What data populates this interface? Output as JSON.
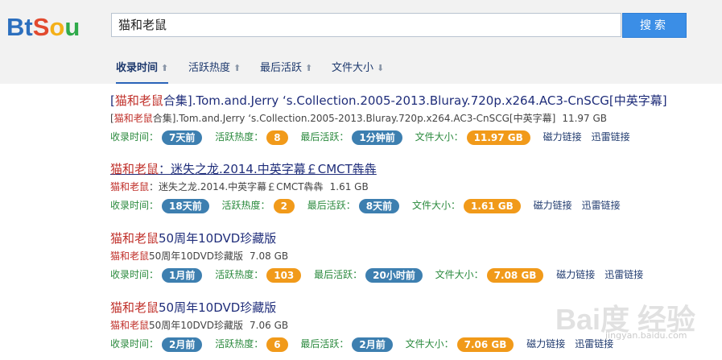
{
  "logo": {
    "parts": [
      {
        "text": "B",
        "color": "#2c6fbe"
      },
      {
        "text": "t",
        "color": "#2c6fbe"
      },
      {
        "text": "S",
        "color": "#e24a2f"
      },
      {
        "text": "o",
        "color": "#f4b019"
      },
      {
        "text": "u",
        "color": "#2faa4a"
      }
    ]
  },
  "search": {
    "value": "猫和老鼠",
    "button": "搜索"
  },
  "sort": [
    {
      "label": "收录时间",
      "active": true
    },
    {
      "label": "活跃热度",
      "active": false
    },
    {
      "label": "最后活跃",
      "active": false
    },
    {
      "label": "文件大小",
      "active": false
    }
  ],
  "labels": {
    "added": "收录时间：",
    "heat": "活跃热度：",
    "last": "最后活跃：",
    "size": "文件大小：",
    "magnet": "磁力链接",
    "thunder": "迅雷链接"
  },
  "results": [
    {
      "title_prefix": "[",
      "title_hl": "猫和老鼠",
      "title_rest": "合集].Tom.and.Jerry ‘s.Collection.2005-2013.Bluray.720p.x264.AC3-CnSCG[中英字幕]",
      "sub_prefix": "[",
      "sub_hl": "猫和老鼠",
      "sub_rest": "合集].Tom.and.Jerry ‘s.Collection.2005-2013.Bluray.720p.x264.AC3-CnSCG[中英字幕]",
      "sub_size": "11.97 GB",
      "added": "7天前",
      "heat": "8",
      "last": "1分钟前",
      "size": "11.97 GB",
      "underline": false
    },
    {
      "title_prefix": "",
      "title_hl": "猫和老鼠",
      "title_rest": "：迷失之龙.2014.中英字幕￡CMCT犇犇",
      "sub_prefix": "",
      "sub_hl": "猫和老鼠",
      "sub_rest": "：迷失之龙.2014.中英字幕￡CMCT犇犇",
      "sub_size": "1.61 GB",
      "added": "18天前",
      "heat": "2",
      "last": "8天前",
      "size": "1.61 GB",
      "underline": true
    },
    {
      "title_prefix": "",
      "title_hl": "猫和老鼠",
      "title_rest": "50周年10DVD珍藏版",
      "sub_prefix": "",
      "sub_hl": "猫和老鼠",
      "sub_rest": "50周年10DVD珍藏版",
      "sub_size": "7.08 GB",
      "added": "1月前",
      "heat": "103",
      "last": "20小时前",
      "size": "7.08 GB",
      "underline": false
    },
    {
      "title_prefix": "",
      "title_hl": "猫和老鼠",
      "title_rest": "50周年10DVD珍藏版",
      "sub_prefix": "",
      "sub_hl": "猫和老鼠",
      "sub_rest": "50周年10DVD珍藏版",
      "sub_size": "7.06 GB",
      "added": "2月前",
      "heat": "6",
      "last": "2月前",
      "size": "7.06 GB",
      "underline": false
    }
  ],
  "watermark": {
    "text": "Bai度 经验",
    "sub": "jingyan.baidu.com"
  },
  "colors": {
    "accent": "#3b8ee6",
    "badge_blue": "#3d7fb0",
    "badge_orange": "#f19a1a",
    "highlight": "#c0312b",
    "label_green": "#2b8a3e"
  }
}
